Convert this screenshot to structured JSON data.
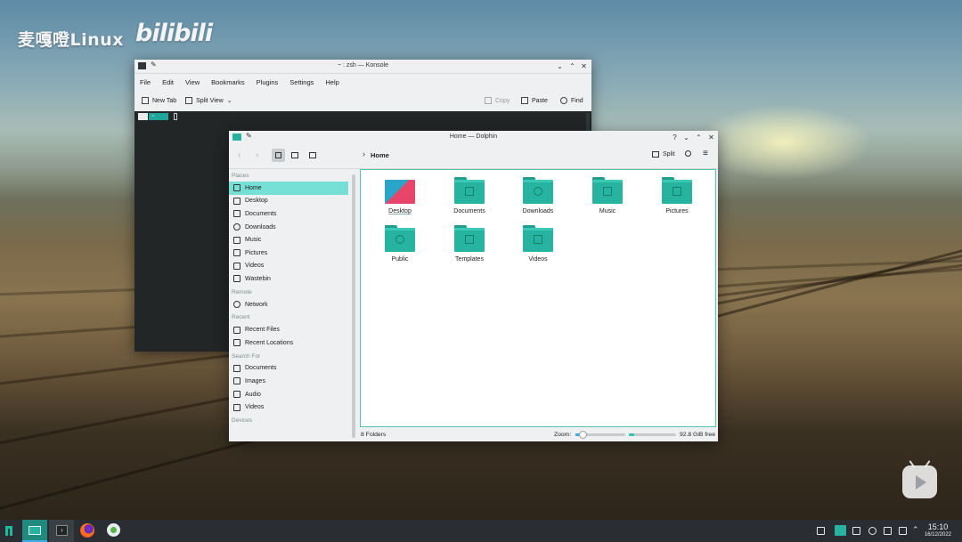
{
  "watermark": {
    "channel": "麦嘎噔Linux",
    "site": "bilibili"
  },
  "konsole": {
    "title": "~ : zsh — Konsole",
    "menu": [
      "File",
      "Edit",
      "View",
      "Bookmarks",
      "Plugins",
      "Settings",
      "Help"
    ],
    "toolbar": {
      "new_tab": "New Tab",
      "split_view": "Split View",
      "copy": "Copy",
      "paste": "Paste",
      "find": "Find"
    },
    "prompt_dir": "~"
  },
  "dolphin": {
    "title": "Home — Dolphin",
    "breadcrumb": "Home",
    "split": "Split",
    "places": {
      "header": "Places",
      "items": [
        "Home",
        "Desktop",
        "Documents",
        "Downloads",
        "Music",
        "Pictures",
        "Videos",
        "Wastebin"
      ]
    },
    "remote": {
      "header": "Remote",
      "items": [
        "Network"
      ]
    },
    "recent": {
      "header": "Recent",
      "items": [
        "Recent Files",
        "Recent Locations"
      ]
    },
    "search": {
      "header": "Search For",
      "items": [
        "Documents",
        "Images",
        "Audio",
        "Videos"
      ]
    },
    "devices": {
      "header": "Devices"
    },
    "folders": [
      "Desktop",
      "Documents",
      "Downloads",
      "Music",
      "Pictures",
      "Public",
      "Templates",
      "Videos"
    ],
    "status": {
      "count": "8 Folders",
      "zoom_label": "Zoom:",
      "free": "92.8 GiB free"
    },
    "zoom_level": 0.15,
    "disk_used_fraction": 0.12
  },
  "taskbar": {
    "time": "15:10",
    "date": "16/12/2022"
  },
  "colors": {
    "accent": "#26b39f",
    "selection": "#76dfd6",
    "taskbar": "#2a2e32"
  }
}
